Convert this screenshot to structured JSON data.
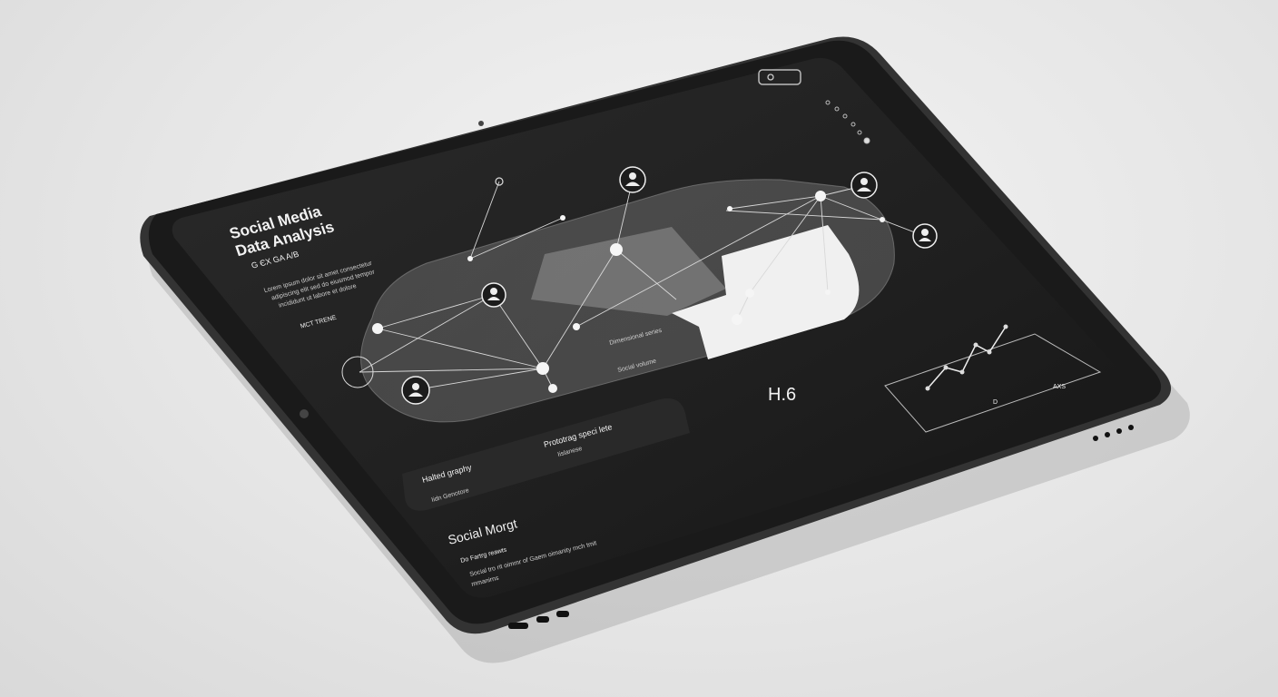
{
  "dashboard": {
    "title_line1": "Social Media",
    "title_line2": "Data Analysis",
    "subtitle": "G ЄX GA A/B",
    "summary_line1": "Lorem ipsum dolor sit amet consectetur",
    "summary_line2": "adipiscing elit sed do eiusmod tempor",
    "summary_line3": "incididunt ut labore et dolore",
    "pill_label": "MCT TRENE",
    "center_value": "H.6",
    "annotation_1": "Dimensional series",
    "annotation_2": "Social volume",
    "card_left_title": "Halted graphy",
    "card_left_sub": "Iidn Genotore",
    "card_right_title": "Prototrag speci lete",
    "card_right_sub": "Iislanese",
    "chart_label_axis": "D",
    "chart_label_right": "AXS",
    "footer_title": "Social Morgt",
    "footer_sub": "Do Fartrg reawts",
    "footer_desc1": "Social tro rit oimmr of Gaem oimanity rnch tmit",
    "footer_desc2": "mmanirns"
  },
  "colors": {
    "bezel": "#2b2b2b",
    "screen": "#1c1c1c",
    "accent": "#ffffff"
  },
  "icons": [
    "camera-icon",
    "toggle-icon",
    "user-node-icon",
    "line-chart-icon"
  ]
}
